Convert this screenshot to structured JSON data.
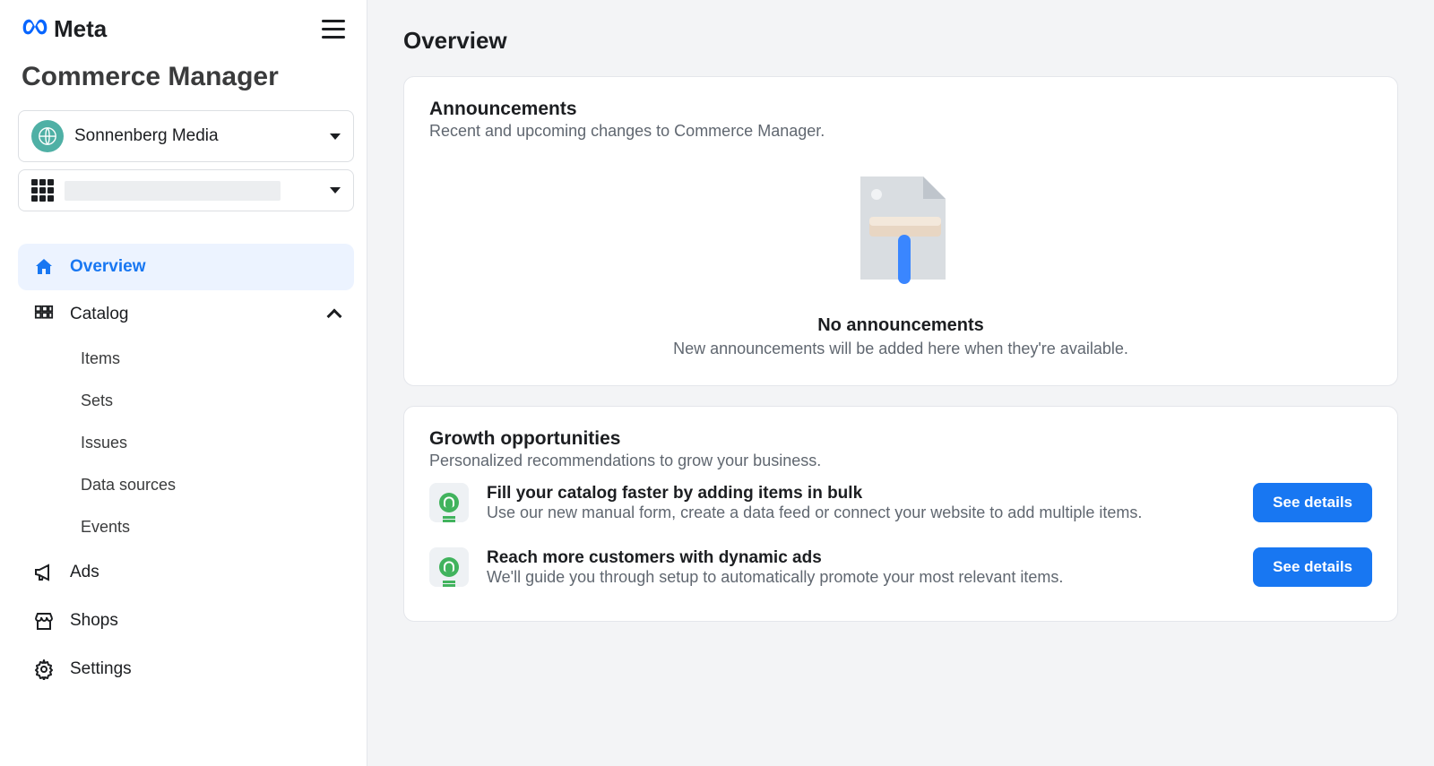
{
  "brand": {
    "name": "Meta"
  },
  "app_title": "Commerce Manager",
  "business_selector": {
    "name": "Sonnenberg Media"
  },
  "nav": {
    "overview": "Overview",
    "catalog": "Catalog",
    "catalog_children": {
      "items": "Items",
      "sets": "Sets",
      "issues": "Issues",
      "data_sources": "Data sources",
      "events": "Events"
    },
    "ads": "Ads",
    "shops": "Shops",
    "settings": "Settings"
  },
  "page": {
    "title": "Overview"
  },
  "announcements": {
    "title": "Announcements",
    "subtitle": "Recent and upcoming changes to Commerce Manager.",
    "empty_title": "No announcements",
    "empty_text": "New announcements will be added here when they're available."
  },
  "growth": {
    "title": "Growth opportunities",
    "subtitle": "Personalized recommendations to grow your business.",
    "items": [
      {
        "title": "Fill your catalog faster by adding items in bulk",
        "text": "Use our new manual form, create a data feed or connect your website to add multiple items.",
        "cta": "See details"
      },
      {
        "title": "Reach more customers with dynamic ads",
        "text": "We'll guide you through setup to automatically promote your most relevant items.",
        "cta": "See details"
      }
    ]
  }
}
